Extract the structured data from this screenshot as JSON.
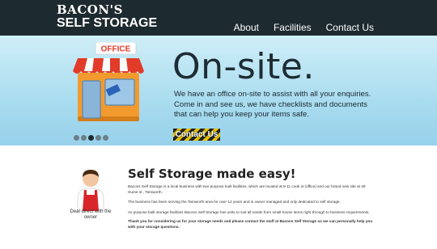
{
  "brand": {
    "line1": "BACON'S",
    "line2": "SELF STORAGE"
  },
  "nav": [
    {
      "label": "About"
    },
    {
      "label": "Facilities"
    },
    {
      "label": "Contact Us"
    }
  ],
  "hero": {
    "sign_text": "OFFICE",
    "title": "On-site.",
    "text": "We have an office on-site to assist with all your enquiries. Come in and see us, we have checklists and documents that can help you keep your items safe.",
    "cta_label": "Contact Us",
    "slider_dots": 5,
    "active_dot": 3
  },
  "main": {
    "title": "Self Storage made easy!",
    "owner_caption": "Deal direct with the owner",
    "paragraphs": [
      "Bacons Self Storage is a local business with two purpose built facilities, which are located at 9-11 cook st (office) and our brand new site at 49 Hume st , Tamworth.",
      "The business has been serving the Tamworth area for over 12 years and is owner managed and only dedicated to self storage.",
      "As purpose built storage facilities Bacons Self Storage has units to suit all needs from small house items right through to business requirements.",
      "Thank you for considering us for your storage needs and please contact the staff at Bacons Self Storage so we can personally help you with your storage questions."
    ]
  },
  "colors": {
    "header": "#1d2a30",
    "hero_bg": "#a9dcef",
    "awning_red": "#e23b2a",
    "building_orange": "#f29a2e"
  }
}
